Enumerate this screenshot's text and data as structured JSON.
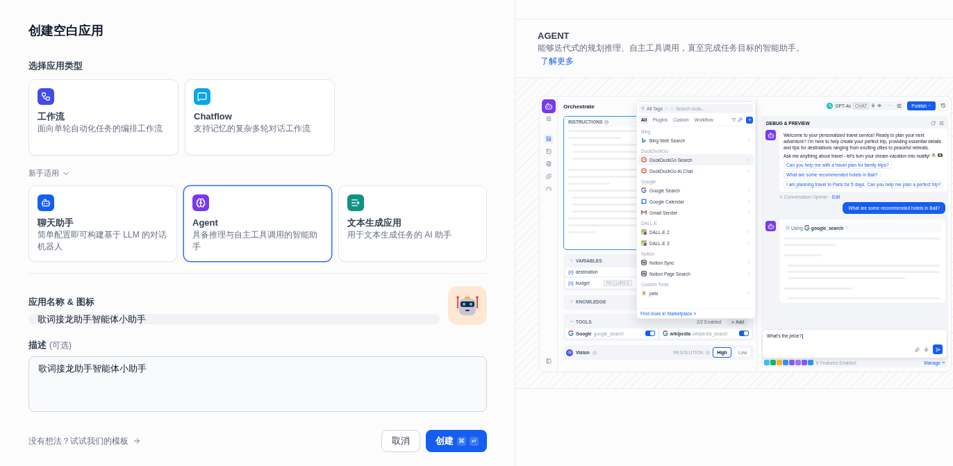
{
  "title": "创建空白应用",
  "type_section": {
    "label": "选择应用类型",
    "types": [
      {
        "kind": "workflow",
        "name": "工作流",
        "description": "面向单轮自动化任务的编排工作流",
        "selected": false
      },
      {
        "kind": "chatflow",
        "name": "Chatflow",
        "description": "支持记忆的复杂多轮对话工作流",
        "selected": false
      }
    ]
  },
  "beginner_section": {
    "label": "新手适用",
    "expanded": true,
    "types": [
      {
        "kind": "chat",
        "name": "聊天助手",
        "description": "简单配置即可构建基于 LLM 的对话机器人",
        "selected": false
      },
      {
        "kind": "agent",
        "name": "Agent",
        "description": "具备推理与自主工具调用的智能助手",
        "selected": true
      },
      {
        "kind": "text",
        "name": "文本生成应用",
        "description": "用于文本生成任务的 AI 助手",
        "selected": false
      }
    ]
  },
  "name_field": {
    "label": "应用名称 & 图标",
    "value": "歌词接龙助手智能体小助手"
  },
  "description_field": {
    "label": "描述",
    "hint": "(可选)",
    "value": "歌词接龙助手智能体小助手"
  },
  "template_link": "没有想法？试试我们的模板",
  "buttons": {
    "cancel": "取消",
    "create": "创建",
    "shortcut_keys": [
      "⌘",
      "↵"
    ]
  },
  "preview": {
    "title": "AGENT",
    "description": "能够迭代式的规划推理、自主工具调用，直至完成任务目标的智能助手。",
    "learn_more": "了解更多",
    "screenshot": {
      "orchestrate": {
        "title": "Orchestrate",
        "instructions_label": "INSTRUCTIONS",
        "variables": {
          "label": "VARIABLES",
          "expanded": true,
          "items": [
            {
              "symbol": "{x}",
              "name": "destination"
            },
            {
              "symbol": "{x}",
              "name": "budget",
              "badge": "REQUIRED"
            }
          ]
        },
        "knowledge": {
          "label": "KNOWLEDGE",
          "expanded": false
        },
        "tools": {
          "label": "TOOLS",
          "expanded": true,
          "count": "2/2 Enabled",
          "add": "Add",
          "items": [
            {
              "kind": "google",
              "name": "Google",
              "id": "google_search",
              "on": true
            },
            {
              "kind": "google",
              "name": "wikipedia",
              "id": "wikipedia_search",
              "on": true
            }
          ]
        },
        "vision": {
          "label": "Vision",
          "resolution_label": "RESOLUTION",
          "options": [
            {
              "label": "High",
              "selected": true
            },
            {
              "label": "Low",
              "selected": false
            }
          ]
        }
      },
      "tool_picker": {
        "tag_filter": "All Tags",
        "search_placeholder": "Search tools...",
        "tabs": [
          {
            "label": "All",
            "selected": true
          },
          {
            "label": "Plugins",
            "selected": false
          },
          {
            "label": "Custom",
            "selected": false
          },
          {
            "label": "Workflow",
            "selected": false
          }
        ],
        "groups": [
          {
            "name": "Bing",
            "tools": [
              {
                "kind": "bing",
                "name": "Bing Web Search",
                "highlighted": false
              }
            ]
          },
          {
            "name": "DuckDuckGo",
            "tools": [
              {
                "kind": "duck",
                "name": "DuckDuckGo Search",
                "highlighted": true
              },
              {
                "kind": "duck",
                "name": "DuckDuckGo AI Chat",
                "highlighted": false
              }
            ]
          },
          {
            "name": "Google",
            "tools": [
              {
                "kind": "google",
                "name": "Google Search",
                "highlighted": false
              },
              {
                "kind": "calendar",
                "name": "Google Calendar",
                "highlighted": false
              },
              {
                "kind": "gmail",
                "name": "Gmail Sender",
                "highlighted": false
              }
            ]
          },
          {
            "name": "DALL-E",
            "tools": [
              {
                "kind": "dalle",
                "name": "DALL-E 2",
                "highlighted": false
              },
              {
                "kind": "dalle",
                "name": "DALL-E 3",
                "highlighted": false
              }
            ]
          },
          {
            "name": "Notion",
            "tools": [
              {
                "kind": "notion",
                "name": "Notion Sync",
                "highlighted": false
              },
              {
                "kind": "notion",
                "name": "Notion Page Search",
                "highlighted": false
              }
            ]
          },
          {
            "name": "Custom Tools",
            "tools": [
              {
                "kind": "custom",
                "name": "pets",
                "highlighted": false
              }
            ]
          }
        ],
        "footer": "Find more in",
        "footer_link": "Marketplace"
      },
      "model": {
        "name": "GPT-4o",
        "badge": "CHAT"
      },
      "publish": "Publish",
      "debug": {
        "title": "DEBUG & PREVIEW",
        "welcome": [
          "Welcome to your personalized travel service! Ready to plan your next adventure? I'm here to help create your perfect trip, providing essential details and tips for destinations ranging from exciting cities to peaceful retreats.",
          "Ask me anything about travel - let's turn your dream vacation into reality!"
        ],
        "suggestions": [
          "Can you help me with a travel plan for family trips?",
          "What are some recommended hotels in Bali?",
          "I am planning travel to Paris for 5 days. Can you help me plan a perfect trip?"
        ],
        "opener_label": "Conversation Opener",
        "opener_separator": "·",
        "opener_edit": "Edit",
        "user_message": "What are some recommended hotels in Bali?",
        "using_label": "Using",
        "using_tool": "google_search",
        "input_value": "What's the price?",
        "features": [
          {
            "color": "#36bffa"
          },
          {
            "color": "#16b364"
          },
          {
            "color": "#fdb022"
          },
          {
            "color": "#2e90fa"
          },
          {
            "color": "#875bf7"
          },
          {
            "color": "#9e77ed"
          },
          {
            "color": "#7a5af8"
          },
          {
            "color": "#2e90fa"
          }
        ],
        "features_label": "8 Features Enabled",
        "manage": "Manage"
      }
    }
  }
}
